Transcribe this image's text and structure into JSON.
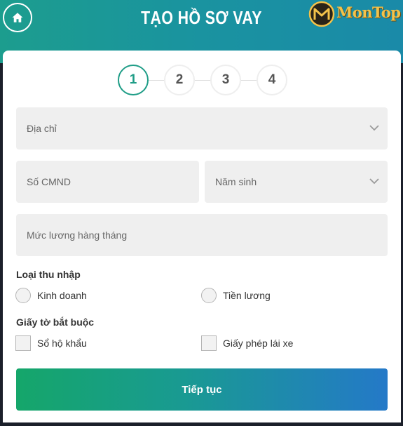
{
  "header": {
    "title": "TẠO HỒ SƠ VAY",
    "logo_text": "MonTop",
    "home_icon": "home-icon"
  },
  "steps": [
    "1",
    "2",
    "3",
    "4"
  ],
  "active_step": 1,
  "form": {
    "address_placeholder": "Địa chỉ",
    "id_placeholder": "Số CMND",
    "birth_year_placeholder": "Năm sinh",
    "salary_placeholder": "Mức lương hàng tháng",
    "income_type_label": "Loại thu nhập",
    "income_options": [
      "Kinh doanh",
      "Tiền lương"
    ],
    "documents_label": "Giấy tờ bắt buộc",
    "document_options": [
      "Sổ hộ khẩu",
      "Giấy phép lái xe"
    ],
    "submit_label": "Tiếp tục"
  },
  "colors": {
    "accent": "#1f9d87",
    "header_start": "#1c9d8e",
    "header_end": "#1a8aa8",
    "button_start": "#15a66a",
    "button_end": "#2479c8"
  }
}
